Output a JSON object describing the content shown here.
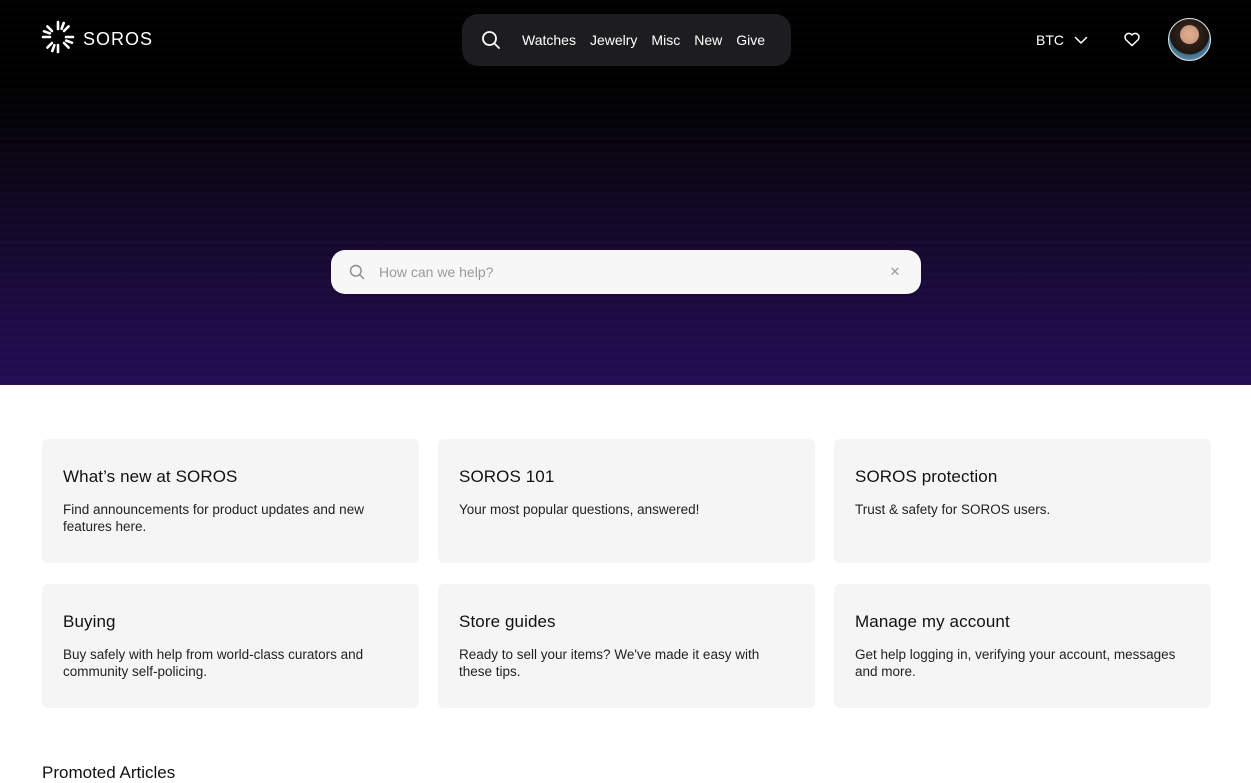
{
  "brand": {
    "name": "SOROS"
  },
  "nav": {
    "items": [
      {
        "label": "Watches"
      },
      {
        "label": "Jewelry"
      },
      {
        "label": "Misc"
      },
      {
        "label": "New"
      },
      {
        "label": "Give"
      }
    ]
  },
  "header": {
    "currency": "BTC"
  },
  "hero": {
    "search": {
      "placeholder": "How can we help?",
      "value": ""
    }
  },
  "cards": [
    {
      "title": "What’s new at SOROS",
      "description": "Find announcements for product updates and new features here."
    },
    {
      "title": "SOROS 101",
      "description": "Your most popular questions, answered!"
    },
    {
      "title": "SOROS protection",
      "description": "Trust & safety for SOROS users."
    },
    {
      "title": "Buying",
      "description": "Buy safely with help from world-class curators and community self-policing."
    },
    {
      "title": "Store guides",
      "description": "Ready to sell your items? We've made it easy with these tips."
    },
    {
      "title": "Manage my account",
      "description": "Get help logging in, verifying your account, messages and more."
    }
  ],
  "sections": {
    "promoted_title": "Promoted Articles"
  },
  "colors": {
    "accent_purple": "#230c55",
    "card_bg": "#f5f5f5",
    "nav_pill": "#1d1d1f"
  },
  "icons": [
    "sunburst-logo-icon",
    "search-icon",
    "chevron-down-icon",
    "heart-icon",
    "close-icon"
  ]
}
